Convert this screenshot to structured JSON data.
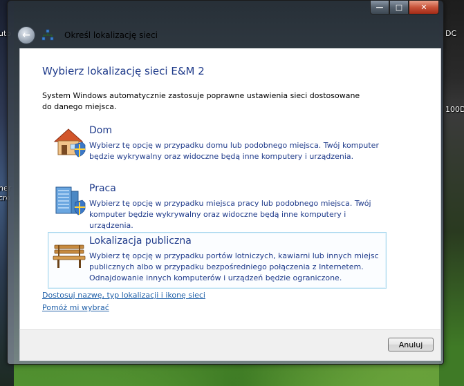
{
  "desktop": {
    "left_label_1": "uto",
    "left_label_2": "ner",
    "left_label_3": "cro",
    "right_label_1": "DC",
    "right_label_2": "100D"
  },
  "window": {
    "controls": {
      "minimize": "—",
      "maximize": "□",
      "close": "✕"
    },
    "nav_title": "Określ lokalizację sieci"
  },
  "content": {
    "heading": "Wybierz lokalizację sieci E&M  2",
    "intro": "System Windows automatycznie zastosuje poprawne ustawienia sieci dostosowane do danego miejsca.",
    "options": [
      {
        "title": "Dom",
        "description": "Wybierz tę opcję w przypadku domu lub podobnego miejsca. Twój komputer będzie wykrywalny oraz widoczne będą inne komputery i urządzenia.",
        "icon": "house-icon"
      },
      {
        "title": "Praca",
        "description": "Wybierz tę opcję w przypadku miejsca pracy lub podobnego miejsca. Twój komputer będzie wykrywalny oraz widoczne będą inne komputery i urządzenia.",
        "icon": "office-building-icon"
      },
      {
        "title": "Lokalizacja publiczna",
        "description": "Wybierz tę opcję w przypadku portów lotniczych, kawiarni lub innych miejsc publicznych albo w przypadku bezpośredniego połączenia z Internetem. Odnajdowanie innych komputerów i urządzeń będzie ograniczone.",
        "icon": "park-bench-icon"
      }
    ],
    "link_customize": "Dostosuj nazwę, typ lokalizacji i ikonę sieci",
    "link_help": "Pomóż mi wybrać"
  },
  "footer": {
    "cancel_label": "Anuluj"
  },
  "colors": {
    "heading_blue": "#1e3a8a",
    "link_blue": "#1f5fa8",
    "selection_border": "#a9d8ee"
  }
}
